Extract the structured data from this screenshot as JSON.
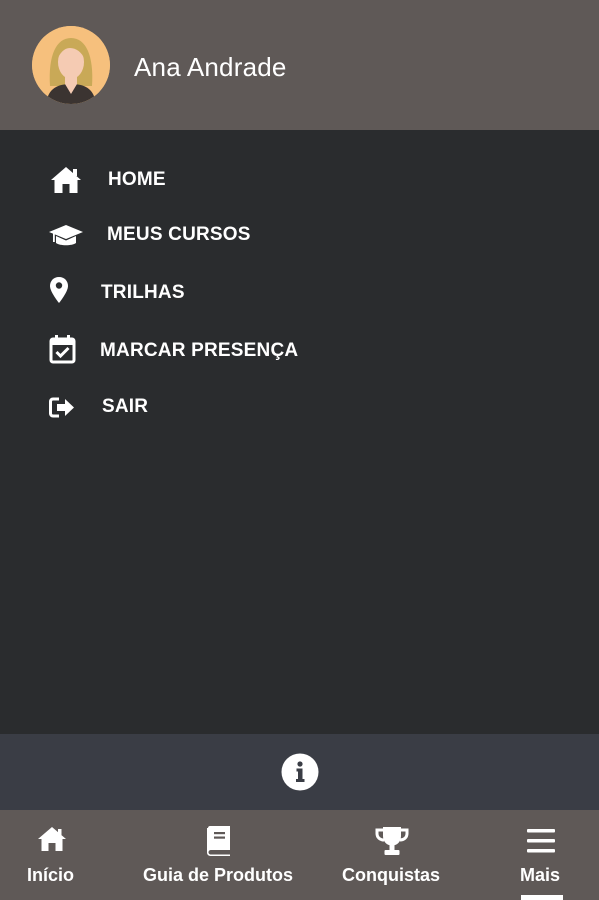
{
  "header": {
    "user_name": "Ana Andrade",
    "background": "#5f5957"
  },
  "menu": {
    "items": [
      {
        "label": "HOME",
        "icon": "home-icon"
      },
      {
        "label": "MEUS CURSOS",
        "icon": "graduation-cap-icon"
      },
      {
        "label": "TRILHAS",
        "icon": "map-marker-icon"
      },
      {
        "label": "MARCAR PRESENÇA",
        "icon": "calendar-check-icon"
      },
      {
        "label": "SAIR",
        "icon": "sign-out-icon"
      }
    ]
  },
  "info_bar": {
    "icon": "info-icon"
  },
  "bottom_nav": {
    "items": [
      {
        "label": "Início",
        "icon": "home-icon"
      },
      {
        "label": "Guia de Produtos",
        "icon": "book-icon"
      },
      {
        "label": "Conquistas",
        "icon": "trophy-icon"
      },
      {
        "label": "Mais",
        "icon": "menu-icon",
        "active": true
      }
    ]
  },
  "colors": {
    "header_bg": "#5f5957",
    "menu_bg": "#2a2c2e",
    "info_bar_bg": "#3a3d45",
    "bottom_nav_bg": "#5f5957",
    "text": "#ffffff"
  }
}
